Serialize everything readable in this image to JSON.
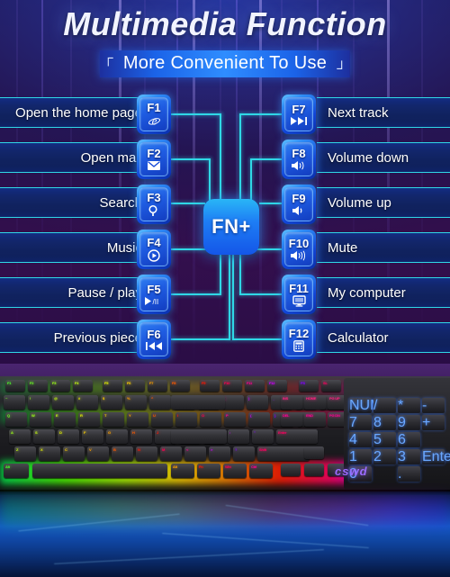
{
  "header": {
    "title": "Multimedia Function",
    "subtitle": "More Convenient To Use",
    "bracket_open": "┌",
    "bracket_close": "┘"
  },
  "center": {
    "fn_label": "FN+"
  },
  "left_column": [
    {
      "key": "F1",
      "label": "Open the home page",
      "icon": "internet-explorer-icon",
      "glyph": "e"
    },
    {
      "key": "F2",
      "label": "Open mail",
      "icon": "envelope-icon",
      "glyph": "✉"
    },
    {
      "key": "F3",
      "label": "Search",
      "icon": "magnifier-icon",
      "glyph": "⚲"
    },
    {
      "key": "F4",
      "label": "Music",
      "icon": "play-circle-icon",
      "glyph": "▶"
    },
    {
      "key": "F5",
      "label": "Pause / play",
      "icon": "play-pause-icon",
      "glyph": "▶/II"
    },
    {
      "key": "F6",
      "label": "Previous piece",
      "icon": "previous-track-icon",
      "glyph": "I◀◀"
    }
  ],
  "right_column": [
    {
      "key": "F7",
      "label": "Next track",
      "icon": "next-track-icon",
      "glyph": "▶▶I"
    },
    {
      "key": "F8",
      "label": "Volume down",
      "icon": "volume-down-icon",
      "glyph": "🔉"
    },
    {
      "key": "F9",
      "label": "Volume up",
      "icon": "volume-up-icon",
      "glyph": "🔈"
    },
    {
      "key": "F10",
      "label": "Mute",
      "icon": "volume-mute-icon",
      "glyph": "🔊"
    },
    {
      "key": "F11",
      "label": "My computer",
      "icon": "monitor-icon",
      "glyph": "▣"
    },
    {
      "key": "F12",
      "label": "Calculator",
      "icon": "calculator-icon",
      "glyph": "▦"
    }
  ],
  "product": {
    "brand": "cswd",
    "function_row": [
      "F1",
      "F2",
      "F3",
      "F4",
      "F5",
      "F6",
      "F7",
      "F8",
      "F9",
      "F10",
      "F11",
      "F12",
      "PS",
      "SL",
      "PB"
    ],
    "row_numbers": [
      "~",
      "!",
      "@",
      "#",
      "$",
      "%",
      "^",
      "&",
      "*",
      "(",
      ")",
      "_",
      "+"
    ],
    "row_q": [
      "Q",
      "W",
      "E",
      "R",
      "T",
      "Y",
      "U",
      "I",
      "O",
      "P",
      "{",
      "}",
      "|"
    ],
    "row_a": [
      "A",
      "S",
      "D",
      "F",
      "G",
      "H",
      "J",
      "K",
      "L",
      ":",
      "\"",
      "Enter"
    ],
    "row_z": [
      "Z",
      "X",
      "C",
      "V",
      "B",
      "N",
      "M",
      "<",
      ">",
      "?",
      "Shift"
    ],
    "row_mod": [
      "Alt",
      "Fn",
      "Win",
      "Ctrl"
    ],
    "nav_keys": [
      "INS",
      "HOME",
      "PG UP",
      "DEL",
      "END",
      "PG DN"
    ],
    "numpad_keys": [
      "NUM",
      "/",
      "*",
      "-",
      "7",
      "8",
      "9",
      "4",
      "5",
      "6",
      "1",
      "2",
      "3",
      "+",
      "0",
      ".",
      "Enter"
    ]
  },
  "colors": {
    "accent_cyan": "#2fd8e6",
    "key_blue": "#1e7ef5",
    "bar_blue": "#122563",
    "title_white": "#f2f4ff",
    "brand_purple": "#9b6cff"
  }
}
